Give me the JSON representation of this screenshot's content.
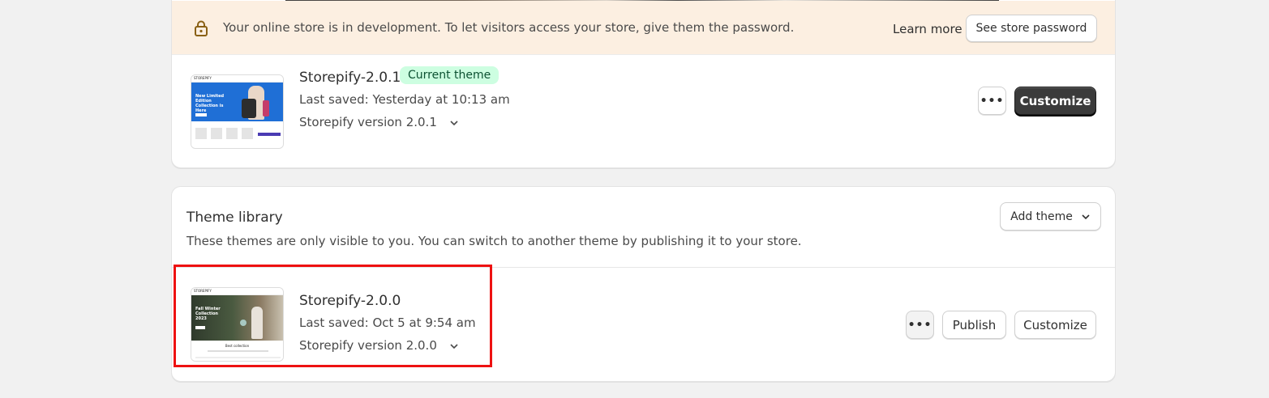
{
  "banner": {
    "message": "Your online store is in development. To let visitors access your store, give them the password.",
    "learn_more": "Learn more",
    "see_password": "See store password",
    "icon": "lock-icon"
  },
  "current_theme": {
    "name": "Storepify-2.0.1",
    "badge": "Current theme",
    "last_saved": "Last saved: Yesterday at 10:13 am",
    "version": "Storepify version 2.0.1",
    "more_label": "•••",
    "customize": "Customize",
    "thumbnail": {
      "brand": "STOREPIFY",
      "headline": "New Limited Edition Collection is Here"
    }
  },
  "library": {
    "title": "Theme library",
    "description": "These themes are only visible to you. You can switch to another theme by publishing it to your store.",
    "add_theme": "Add theme",
    "themes": [
      {
        "name": "Storepify-2.0.0",
        "last_saved": "Last saved: Oct 5 at 9:54 am",
        "version": "Storepify version 2.0.0",
        "more_label": "•••",
        "publish": "Publish",
        "customize": "Customize",
        "thumbnail": {
          "brand": "STOREPIFY",
          "headline": "Fall Winter Collection 2023",
          "section": "Best collection"
        }
      }
    ]
  },
  "colors": {
    "banner_bg": "#fcefe1",
    "badge_bg": "#cdfee1",
    "badge_text": "#0c5132",
    "primary_button": "#3b3b3b",
    "highlight": "#ee1111",
    "thumb_blue": "#1f6fd6"
  }
}
